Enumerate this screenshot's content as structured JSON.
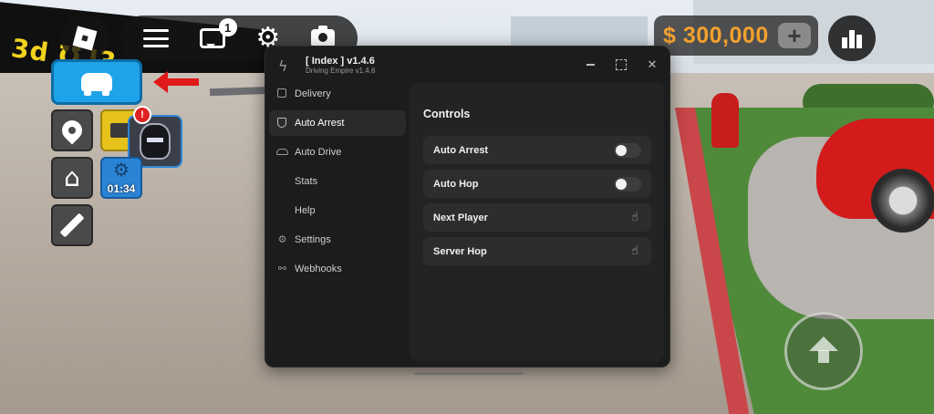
{
  "game": {
    "billboard_text": "3d ℧⅃3",
    "chat_badge": "1",
    "money": "$ 300,000",
    "money_plus": "+",
    "timer": "01:34",
    "notif_badge": "!"
  },
  "window": {
    "title": "[ Index ] v1.4.6",
    "subtitle": "Driving Empire v1.4.6"
  },
  "sidebar": {
    "items": [
      {
        "label": "Delivery",
        "icon": "box-icon"
      },
      {
        "label": "Auto Arrest",
        "icon": "shield-icon"
      },
      {
        "label": "Auto Drive",
        "icon": "car-icon"
      },
      {
        "label": "Stats",
        "icon": ""
      },
      {
        "label": "Help",
        "icon": ""
      },
      {
        "label": "Settings",
        "icon": "gear-icon"
      },
      {
        "label": "Webhooks",
        "icon": "webhook-icon"
      }
    ],
    "active": "Auto Arrest"
  },
  "controls": {
    "title": "Controls",
    "rows": [
      {
        "label": "Auto Arrest",
        "type": "toggle",
        "on": false
      },
      {
        "label": "Auto Hop",
        "type": "toggle",
        "on": false
      },
      {
        "label": "Next Player",
        "type": "button",
        "icon": "click-icon"
      },
      {
        "label": "Server Hop",
        "type": "button",
        "icon": "click-icon"
      }
    ]
  },
  "colors": {
    "window_bg": "#1c1c1c",
    "panel_bg": "#232323",
    "row_bg": "#2d2d2d",
    "money": "#f3a12f",
    "car_button": "#1fa3e8"
  }
}
